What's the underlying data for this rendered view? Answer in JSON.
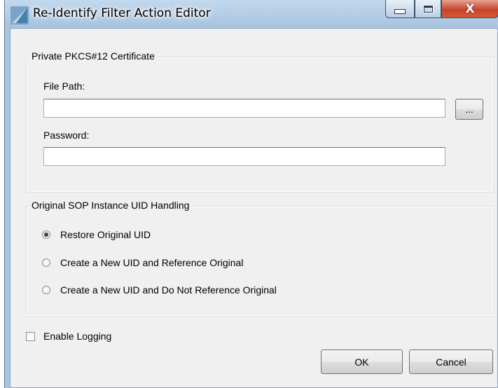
{
  "window": {
    "title": "Re-Identify Filter Action Editor",
    "icon": "dicom-filter-app-icon",
    "controls": {
      "minimize_icon": "minimize-icon",
      "maximize_icon": "maximize-icon",
      "close_label": "X"
    }
  },
  "certificate_group": {
    "legend": "Private PKCS#12 Certificate",
    "file_path_label": "File Path:",
    "file_path_value": "",
    "browse_label": "...",
    "password_label": "Password:",
    "password_value": ""
  },
  "uid_group": {
    "legend": "Original SOP Instance UID Handling",
    "options": [
      {
        "label": "Restore Original UID",
        "checked": true
      },
      {
        "label": "Create a New UID and Reference Original",
        "checked": false
      },
      {
        "label": "Create a New UID and Do Not Reference Original",
        "checked": false
      }
    ]
  },
  "logging": {
    "label": "Enable Logging",
    "checked": false
  },
  "buttons": {
    "ok": "OK",
    "cancel": "Cancel"
  },
  "colors": {
    "title_bar": "#a9c4dd",
    "close_button": "#c8432a",
    "dialog_bg": "#f0f0f0"
  }
}
